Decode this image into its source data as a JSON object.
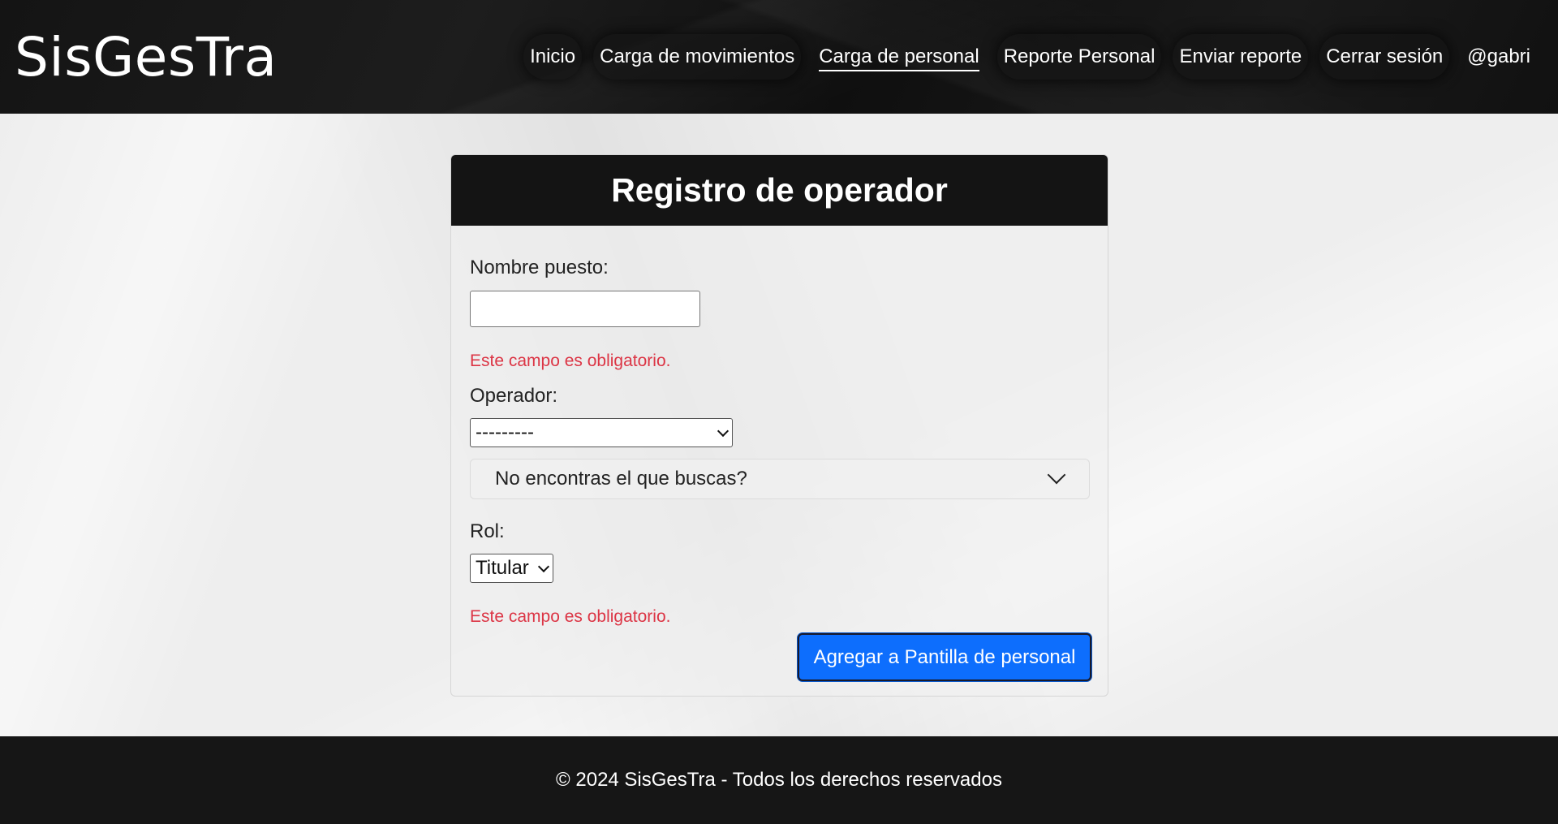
{
  "app": {
    "brand": "SisGesTra"
  },
  "nav": {
    "items": [
      {
        "label": "Inicio"
      },
      {
        "label": "Carga de movimientos"
      },
      {
        "label": "Carga de personal"
      },
      {
        "label": "Reporte Personal"
      },
      {
        "label": "Enviar reporte"
      },
      {
        "label": "Cerrar sesión"
      },
      {
        "label": "@gabri"
      }
    ],
    "active": "Carga de personal"
  },
  "form": {
    "title": "Registro de operador",
    "nombre_puesto": {
      "label": "Nombre puesto:",
      "value": "",
      "error": "Este campo es obligatorio."
    },
    "operador": {
      "label": "Operador:",
      "selected": "---------"
    },
    "accordion": {
      "label": "No encontras el que buscas?"
    },
    "rol": {
      "label": "Rol:",
      "selected": "Titular",
      "error": "Este campo es obligatorio."
    },
    "submit_label": "Agregar a Pantilla de personal"
  },
  "footer": {
    "text": "© 2024 SisGesTra - Todos los derechos reservados"
  },
  "colors": {
    "primary": "#0d6efd",
    "error": "#dc3545",
    "header_bg": "#141414"
  }
}
